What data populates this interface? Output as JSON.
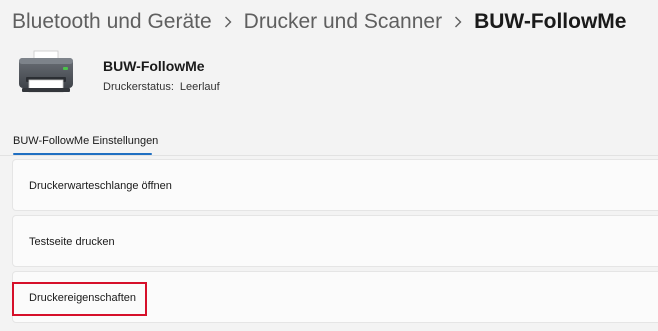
{
  "breadcrumb": {
    "items": [
      "Bluetooth und Geräte",
      "Drucker und Scanner",
      "BUW-FollowMe"
    ],
    "separator_icon": "chevron-right-icon"
  },
  "device": {
    "icon": "printer-icon",
    "name": "BUW-FollowMe",
    "status_label": "Druckerstatus:",
    "status_value": "Leerlauf"
  },
  "section": {
    "tab_label": "BUW-FollowMe Einstellungen",
    "accent_color": "#1f6fc2"
  },
  "settings": [
    {
      "label": "Druckerwarteschlange öffnen"
    },
    {
      "label": "Testseite drucken"
    },
    {
      "label": "Druckereigenschaften",
      "highlighted": true
    }
  ],
  "highlight_color": "#d6102a"
}
